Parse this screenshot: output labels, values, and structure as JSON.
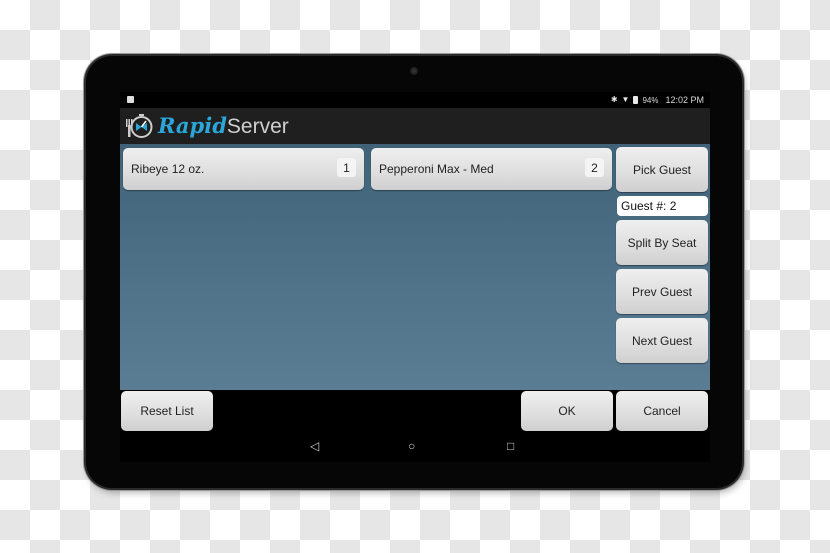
{
  "status_bar": {
    "notification_icon": "image-notification-icon",
    "bluetooth_icon": "bluetooth-icon",
    "wifi_icon": "wifi-icon",
    "battery_icon": "battery-icon",
    "battery": "94%",
    "time": "12:02 PM"
  },
  "app": {
    "logo_icon": "stopwatch-fork-icon",
    "name_part1": "Rapid",
    "name_part2": "Server",
    "brand_color": "#2aa6d8"
  },
  "items": [
    {
      "name": "Ribeye 12 oz.",
      "quantity": "1"
    },
    {
      "name": "Pepperoni Max - Med",
      "quantity": "2"
    }
  ],
  "side_panel": {
    "pick_guest": "Pick Guest",
    "guest_field": "Guest #: 2",
    "split_by_seat": "Split By Seat",
    "prev_guest": "Prev Guest",
    "next_guest": "Next Guest"
  },
  "footer": {
    "reset_list": "Reset List",
    "ok": "OK",
    "cancel": "Cancel"
  },
  "nav": {
    "back": "◁",
    "home": "○",
    "recents": "□"
  }
}
